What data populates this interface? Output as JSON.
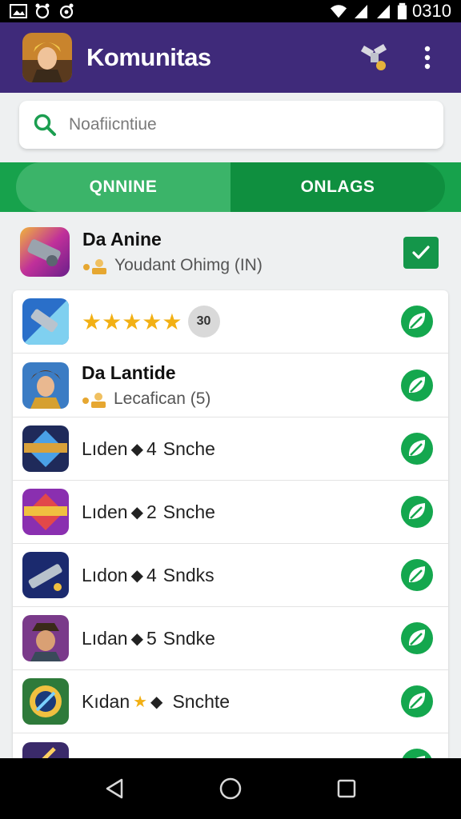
{
  "status_bar": {
    "time": "0310"
  },
  "app_bar": {
    "title": "Komunitas"
  },
  "search": {
    "placeholder": "Noafiicntiue"
  },
  "tabs": [
    {
      "label": "QNNINE"
    },
    {
      "label": "ONLAGS"
    }
  ],
  "featured": {
    "title": "Da Anine",
    "subtitle": "Youdant Ohimg (IN)"
  },
  "list": {
    "rating_row": {
      "stars": "★★★★★",
      "badge": "30"
    },
    "second": {
      "title": "Da Lantide",
      "subtitle": "Lecafican (5)"
    },
    "rows": [
      {
        "name": "Lıden",
        "count": "4",
        "unit": "Snche"
      },
      {
        "name": "Lıden",
        "count": "2",
        "unit": "Snche"
      },
      {
        "name": "Lıdon",
        "count": "4",
        "unit": "Sndks"
      },
      {
        "name": "Lıdan",
        "count": "5",
        "unit": "Sndke"
      },
      {
        "name": "Kıdan",
        "count": "",
        "unit": "Snchte"
      }
    ]
  },
  "colors": {
    "app_bar": "#3f2a7a",
    "accent_green": "#17a24c",
    "check_green": "#14964a",
    "star": "#f2b014"
  },
  "icons": [
    "photo-icon",
    "alarm-icon",
    "wifi-icon",
    "signal-icon",
    "battery-icon",
    "satellite-icon",
    "more-vert-icon",
    "search-icon",
    "check-icon",
    "leaf-icon",
    "back-icon",
    "home-icon",
    "recents-icon"
  ]
}
